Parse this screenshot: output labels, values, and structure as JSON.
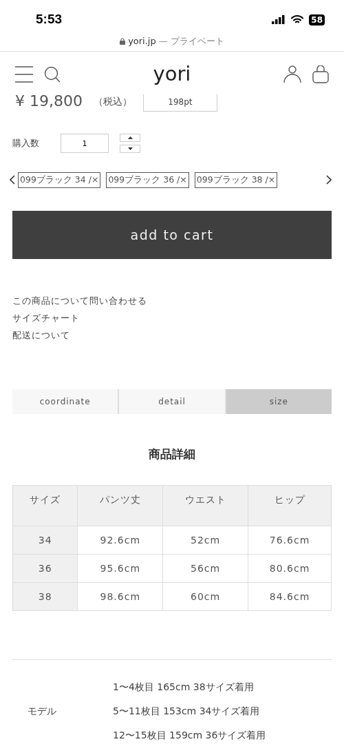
{
  "status_bar": {
    "time": "5:53",
    "battery": "58"
  },
  "address_bar": {
    "domain": "yori.jp",
    "suffix": "— プライベート"
  },
  "header": {
    "logo": "yori"
  },
  "price": {
    "amount": "¥ 19,800",
    "tax_note": "（税込）",
    "points": "198pt"
  },
  "quantity": {
    "label": "購入数",
    "value": "1"
  },
  "variants": [
    {
      "label": "099ブラック 34 /×"
    },
    {
      "label": "099ブラック 36 /×"
    },
    {
      "label": "099ブラック 38 /×"
    }
  ],
  "add_to_cart": "add to cart",
  "links": [
    "この商品について問い合わせる",
    "サイズチャート",
    "配送について"
  ],
  "tabs": [
    {
      "label": "coordinate",
      "selected": false
    },
    {
      "label": "detail",
      "selected": false
    },
    {
      "label": "size",
      "selected": true
    }
  ],
  "section_title": "商品詳細",
  "table": {
    "columns": [
      "サイズ",
      "パンツ丈",
      "ウエスト",
      "ヒップ"
    ],
    "rows": [
      [
        "34",
        "92.6cm",
        "52cm",
        "76.6cm"
      ],
      [
        "36",
        "95.6cm",
        "56cm",
        "80.6cm"
      ],
      [
        "38",
        "98.6cm",
        "60cm",
        "84.6cm"
      ]
    ]
  },
  "model": {
    "label": "モデル",
    "lines": [
      "1〜4枚目 165cm 38サイズ着用",
      "5〜11枚目 153cm 34サイズ着用",
      "12〜15枚目 159cm 36サイズ着用"
    ]
  }
}
